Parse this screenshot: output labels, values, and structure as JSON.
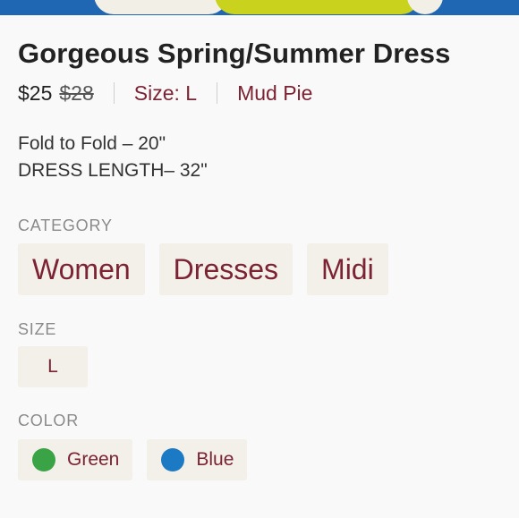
{
  "listing": {
    "title": "Gorgeous Spring/Summer Dress",
    "price": "$25",
    "original_price": "$28",
    "size_text": "Size: L",
    "brand": "Mud Pie"
  },
  "description": {
    "line1": "Fold to Fold – 20\"",
    "line2": "DRESS LENGTH– 32\""
  },
  "category": {
    "label": "CATEGORY",
    "chips": [
      "Women",
      "Dresses",
      "Midi"
    ]
  },
  "size": {
    "label": "SIZE",
    "value": "L"
  },
  "color": {
    "label": "COLOR",
    "options": [
      {
        "name": "Green",
        "swatch": "#3aa346"
      },
      {
        "name": "Blue",
        "swatch": "#1c7ac4"
      }
    ]
  },
  "colors": {
    "accent": "#7b2233",
    "chip_bg": "#f3efe9",
    "photo_blue": "#1f67b3",
    "photo_yellow": "#c9d31d"
  }
}
